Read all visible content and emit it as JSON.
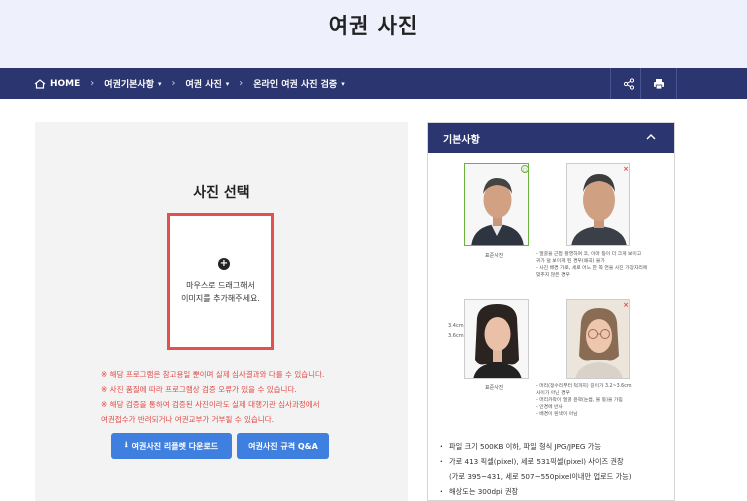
{
  "header": {
    "title": "여권 사진"
  },
  "nav": {
    "crumbs": [
      {
        "label": "HOME",
        "dropdown": false
      },
      {
        "label": "여권기본사항",
        "dropdown": true
      },
      {
        "label": "여권 사진",
        "dropdown": true
      },
      {
        "label": "온라인 여권 사진 검증",
        "dropdown": true
      }
    ],
    "separator": "›",
    "caret": "▾",
    "share_icon": "share-icon",
    "print_icon": "print-icon"
  },
  "uploader": {
    "title": "사진 선택",
    "plus": "+",
    "hint_line1": "마우스로 드래그해서",
    "hint_line2": "이미지를 추가해주세요.",
    "notes": [
      "※ 해당 프로그램은 참고용일 뿐이며 실제 심사결과와 다를 수 있습니다.",
      "※ 사진 품질에 따라 프로그램상 검증 오류가 있을 수 있습니다.",
      "※ 해당 검증을 통하여 검증된 사진이라도 실제 대행기관 심사과정에서",
      "여권접수가 반려되거나 여권교부가 거부될 수 있습니다."
    ],
    "download_button": "여권사진 리플렛 다운로드",
    "download_icon": "⭳",
    "qa_button": "여권사진 규격 Q&A"
  },
  "panel": {
    "title": "기본사항",
    "collapse_icon": "chevron-up-icon",
    "examples": [
      {
        "caption": "표준사진",
        "status": "ok",
        "mark": "○",
        "desc": []
      },
      {
        "caption": "",
        "status": "bad",
        "mark": "×",
        "desc": [
          "- 얼굴을 근접 촬영하여 코, 이마 등이 더 크게 보이고",
          "  귀가 덜 보이게 된 경우(왜곡) 불가",
          "- 사진 배경 가로, 세로 어느 한 쪽 면을 사진 가장자리에",
          "  맞추지 않은 경우"
        ]
      },
      {
        "caption": "표준사진",
        "status": "ok",
        "mark": "○",
        "desc": [],
        "dim_top": "3.4cm",
        "dim_bottom": "3.6cm"
      },
      {
        "caption": "",
        "status": "bad",
        "mark": "×",
        "desc": [
          "- 머리(정수리부터 턱까지) 길이가 3.2~3.6cm",
          "  사이가 아닌 경우",
          "- 머리카락이 얼굴 윤곽(눈썹, 볼 등)을 가림",
          "- 안경에 반사",
          "- 배경이 흰색이 아님"
        ]
      }
    ],
    "rules": [
      "파일 크기 500KB 이하, 파일 형식 JPG/JPEG 가능",
      "가로 413 픽셀(pixel), 세로 531픽셀(pixel) 사이즈 권장",
      "(가로 395~431, 세로 507~550pixel이내만 업로드 가능)",
      "해상도는 300dpi 권장"
    ]
  }
}
